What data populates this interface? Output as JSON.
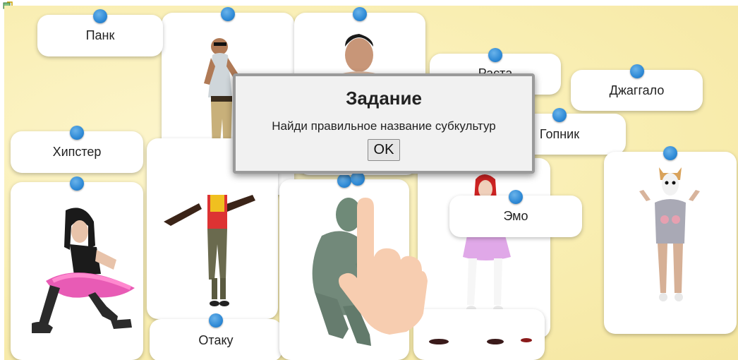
{
  "labels": {
    "punk": "Панк",
    "rasta": "Раста",
    "juggalo": "Джаггало",
    "hipster": "Хипстер",
    "gopnik": "Гопник",
    "emo": "Эмо",
    "otaku": "Отаку"
  },
  "dialog": {
    "title": "Задание",
    "text": "Найди правильное название субкультур",
    "ok_label": "OK"
  },
  "colors": {
    "pin": "#2f8ad6",
    "board": "#f9eeb2"
  }
}
